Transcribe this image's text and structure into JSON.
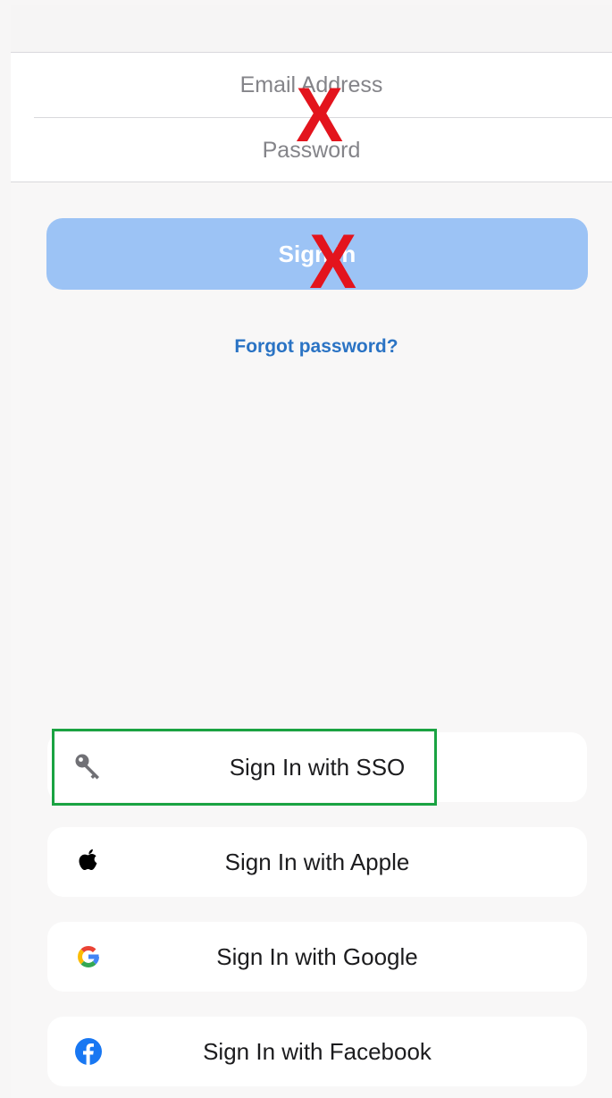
{
  "login_form": {
    "email_placeholder": "Email Address",
    "password_placeholder": "Password"
  },
  "signin_button": {
    "label": "Sign In"
  },
  "forgot_password": {
    "label": "Forgot password?"
  },
  "annotations": {
    "cross_mark": "X",
    "cross_color": "#e3141d",
    "highlight_color": "#1aa342"
  },
  "providers": [
    {
      "label": "Sign In with SSO",
      "icon": "key-icon"
    },
    {
      "label": "Sign In with Apple",
      "icon": "apple-icon"
    },
    {
      "label": "Sign In with Google",
      "icon": "google-icon"
    },
    {
      "label": "Sign In with Facebook",
      "icon": "facebook-icon"
    }
  ],
  "colors": {
    "background": "#f8f7f7",
    "primary_button": "#9cc3f5",
    "link": "#2a73c4",
    "facebook_blue": "#1877f2"
  }
}
